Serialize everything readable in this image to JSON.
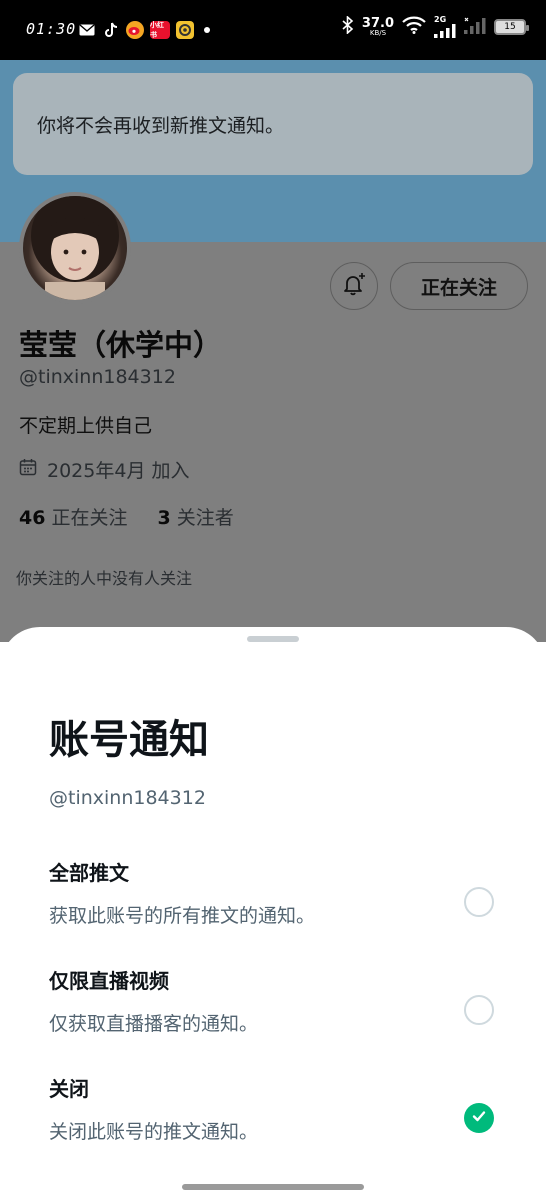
{
  "status_bar": {
    "time": "01:30",
    "notif_icons": [
      "mail-icon",
      "tiktok-icon",
      "weibo-icon",
      "xiaohongshu-icon",
      "app-icon"
    ],
    "red_badge": "小红书",
    "speed_value": "37.0",
    "speed_unit": "KB/S",
    "network": "2G",
    "battery": "15"
  },
  "toast": {
    "text": "你将不会再收到新推文通知。"
  },
  "profile": {
    "following_button": "正在关注",
    "display_name": "莹莹（休学中）",
    "handle": "@tinxinn184312",
    "bio": "不定期上供自己",
    "joined": "2025年4月 加入",
    "following_count": "46",
    "following_label": "正在关注",
    "followers_count": "3",
    "followers_label": "关注者",
    "mutuals": "你关注的人中没有人关注"
  },
  "sheet": {
    "title": "账号通知",
    "handle": "@tinxinn184312",
    "options": [
      {
        "title": "全部推文",
        "desc": "获取此账号的所有推文的通知。",
        "checked": false
      },
      {
        "title": "仅限直播视频",
        "desc": "仅获取直播播客的通知。",
        "checked": false
      },
      {
        "title": "关闭",
        "desc": "关闭此账号的推文通知。",
        "checked": true
      }
    ]
  },
  "colors": {
    "banner": "#5b8fae",
    "check_green": "#00ba7c",
    "text_primary": "#0f1419",
    "text_secondary": "#536471"
  }
}
